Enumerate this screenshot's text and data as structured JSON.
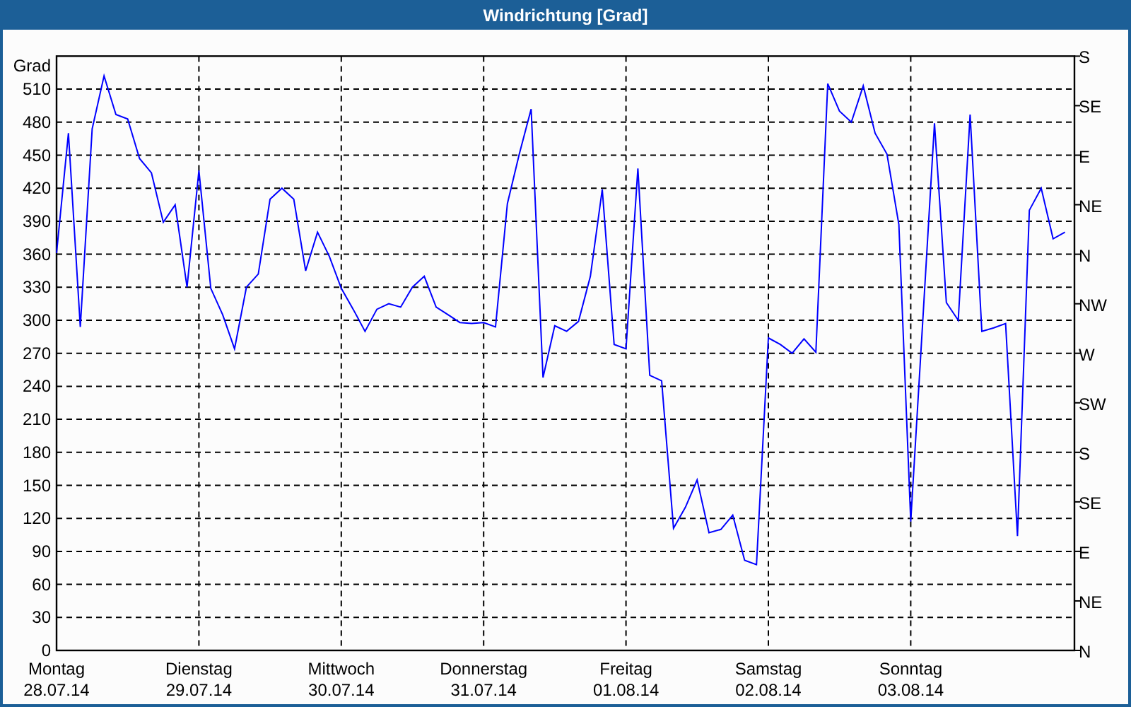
{
  "window": {
    "title": "Windrichtung [Grad]"
  },
  "chart": {
    "chart_data": {
      "type": "line",
      "grid": true,
      "ylabel": "Grad",
      "ylim": [
        0,
        540
      ],
      "yticks": [
        0,
        30,
        60,
        90,
        120,
        150,
        180,
        210,
        240,
        270,
        300,
        330,
        360,
        390,
        420,
        450,
        480,
        510
      ],
      "categories": [
        "Montag",
        null,
        null,
        null,
        null,
        null,
        null,
        null,
        null,
        null,
        null,
        null,
        "Dienstag",
        null,
        null,
        null,
        null,
        null,
        null,
        null,
        null,
        null,
        null,
        null,
        "Mittwoch",
        null,
        null,
        null,
        null,
        null,
        null,
        null,
        null,
        null,
        null,
        null,
        "Donnerstag",
        null,
        null,
        null,
        null,
        null,
        null,
        null,
        null,
        null,
        null,
        null,
        "Freitag",
        null,
        null,
        null,
        null,
        null,
        null,
        null,
        null,
        null,
        null,
        null,
        "Samstag",
        null,
        null,
        null,
        null,
        null,
        null,
        null,
        null,
        null,
        null,
        null,
        "Sonntag",
        null,
        null,
        null,
        null,
        null,
        null,
        null,
        null,
        null,
        null,
        null,
        null,
        null
      ],
      "series": [
        {
          "color": "#0000ff",
          "values": [
            361,
            470,
            294,
            474,
            522,
            487,
            483,
            447,
            434,
            389,
            405,
            330,
            436,
            329,
            305,
            274,
            330,
            342,
            410,
            420,
            410,
            345,
            380,
            358,
            329,
            310,
            290,
            310,
            315,
            312,
            330,
            340,
            312,
            305,
            298,
            297,
            298,
            294,
            406,
            451,
            492,
            248,
            295,
            290,
            299,
            340,
            419,
            278,
            274,
            438,
            250,
            245,
            111,
            130,
            155,
            107,
            110,
            123,
            82,
            78,
            284,
            278,
            270,
            283,
            271,
            515,
            490,
            480,
            513,
            470,
            451,
            387,
            117,
            297,
            479,
            316,
            300,
            487,
            290,
            293,
            297,
            104,
            400,
            420,
            374,
            380
          ]
        }
      ]
    },
    "right_axis": {
      "labels": [
        "S",
        "SE",
        "E",
        "NE",
        "N",
        "NW",
        "W",
        "SW",
        "S",
        "SE",
        "E",
        "NE",
        "N"
      ]
    },
    "dates": [
      "28.07.14",
      "29.07.14",
      "30.07.14",
      "31.07.14",
      "01.08.14",
      "02.08.14",
      "03.08.14"
    ]
  }
}
